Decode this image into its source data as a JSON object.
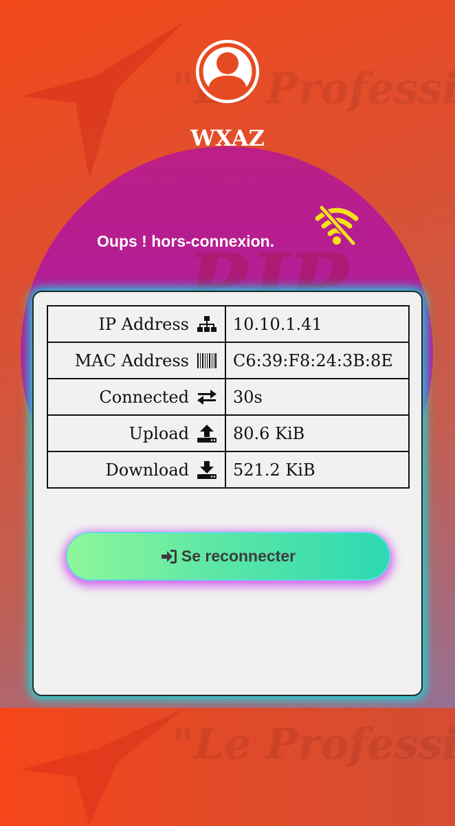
{
  "header": {
    "title": "WXAZ",
    "watermark": "\"Le Professionnel\"",
    "circle_watermark": "PJP"
  },
  "status": {
    "message": "Oups ! hors-connexion.",
    "icon": "wifi-off-icon"
  },
  "info_table": [
    {
      "label": "IP Address",
      "icon": "sitemap-icon",
      "value": "10.10.1.41"
    },
    {
      "label": "MAC Address",
      "icon": "barcode-icon",
      "value": "C6:39:F8:24:3B:8E"
    },
    {
      "label": "Connected",
      "icon": "exchange-icon",
      "value": "30s"
    },
    {
      "label": "Upload",
      "icon": "upload-icon",
      "value": "80.6 KiB"
    },
    {
      "label": "Download",
      "icon": "download-icon",
      "value": "521.2 KiB"
    }
  ],
  "reconnect_button": {
    "label": "Se reconnecter",
    "icon": "sign-in-icon"
  },
  "colors": {
    "background_top": "#f2491a",
    "circle": "#b11d98",
    "wifi_icon": "#f6e11b",
    "card_glow": "#00ebeb",
    "button_start": "#8ff79a",
    "button_end": "#2dd9b3",
    "button_glow": "#c636e6"
  }
}
